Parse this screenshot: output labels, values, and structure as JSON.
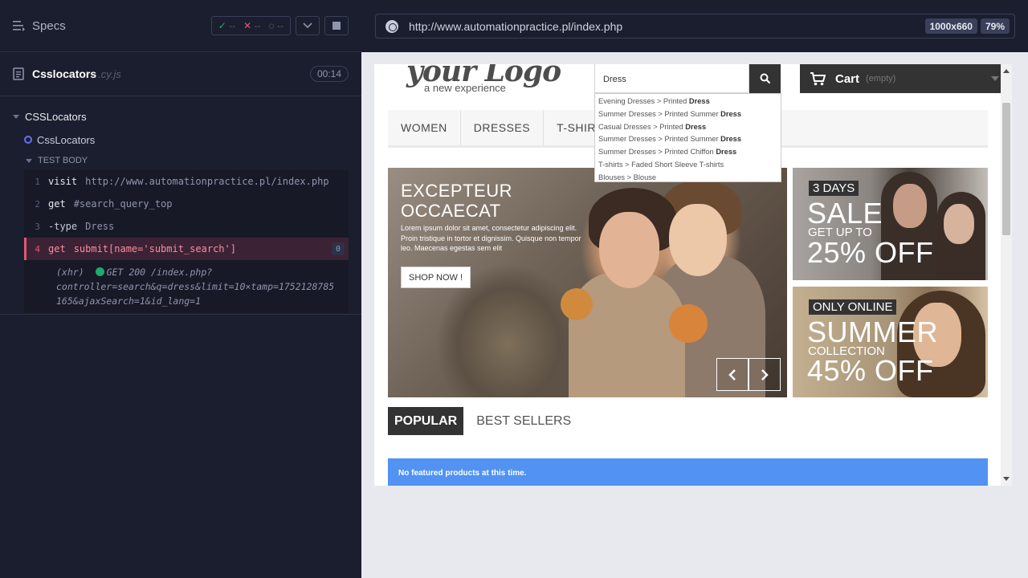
{
  "runner": {
    "specs_label": "Specs",
    "stats": {
      "passed": "--",
      "failed": "--",
      "pending": "--"
    },
    "spec_file": {
      "name": "Csslocators",
      "ext": ".cy.js",
      "duration": "00:14"
    },
    "suite": "CSSLocators",
    "test": "CssLocators",
    "test_body_label": "TEST BODY",
    "commands": [
      {
        "num": "1",
        "name": "visit",
        "message": "http://www.automationpractice.pl/index.php"
      },
      {
        "num": "2",
        "name": "get",
        "message": "#search_query_top"
      },
      {
        "num": "3",
        "name": "-type",
        "message": "Dress"
      },
      {
        "num": "4",
        "name": "get",
        "message": "submit[name='submit_search']",
        "badge": "0"
      }
    ],
    "xhr": {
      "prefix": "(xhr)",
      "line1": "GET 200 /index.php?",
      "line2": "controller=search&q=dress&limit=10×tamp=1752128785",
      "line3": "165&ajaxSearch=1&id_lang=1"
    }
  },
  "preview": {
    "url": "http://www.automationpractice.pl/index.php",
    "viewport_size": "1000x660",
    "zoom": "79%"
  },
  "site": {
    "logo": {
      "main": "your Logo",
      "sub": "a new experience"
    },
    "search_value": "Dress",
    "cart": {
      "label": "Cart",
      "status": "(empty)"
    },
    "menu": [
      "WOMEN",
      "DRESSES",
      "T-SHIRTS"
    ],
    "autocomplete": [
      {
        "prefix": "Evening Dresses > Printed ",
        "bold": "Dress"
      },
      {
        "prefix": "Summer Dresses > Printed Summer ",
        "bold": "Dress"
      },
      {
        "prefix": "Casual Dresses > Printed ",
        "bold": "Dress"
      },
      {
        "prefix": "Summer Dresses > Printed Summer ",
        "bold": "Dress"
      },
      {
        "prefix": "Summer Dresses > Printed Chiffon ",
        "bold": "Dress"
      },
      {
        "prefix": "T-shirts > Faded Short Sleeve T-shirts",
        "bold": ""
      },
      {
        "prefix": "Blouses > Blouse",
        "bold": ""
      }
    ],
    "slide": {
      "title_line1": "EXCEPTEUR",
      "title_line2": "OCCAECAT",
      "text": "Lorem ipsum dolor sit amet, consectetur adipiscing elit. Proin tristique in tortor et dignissim. Quisque non tempor leo. Maecenas egestas sem elit",
      "button": "SHOP NOW !"
    },
    "promo1": {
      "tag": "3 DAYS",
      "big": "SALE",
      "mid": "GET UP TO",
      "percent": "25% OFF"
    },
    "promo2": {
      "tag": "ONLY ONLINE",
      "big": "SUMMER",
      "mid": "COLLECTION",
      "percent": "45% OFF"
    },
    "tabs": [
      "POPULAR",
      "BEST SELLERS"
    ],
    "alert": "No featured products at this time."
  },
  "colors": {
    "runner_bg": "#1b1e2e",
    "pass": "#1fa971",
    "fail": "#e45770",
    "site_dark": "#333333",
    "alert_blue": "#5192f3"
  }
}
